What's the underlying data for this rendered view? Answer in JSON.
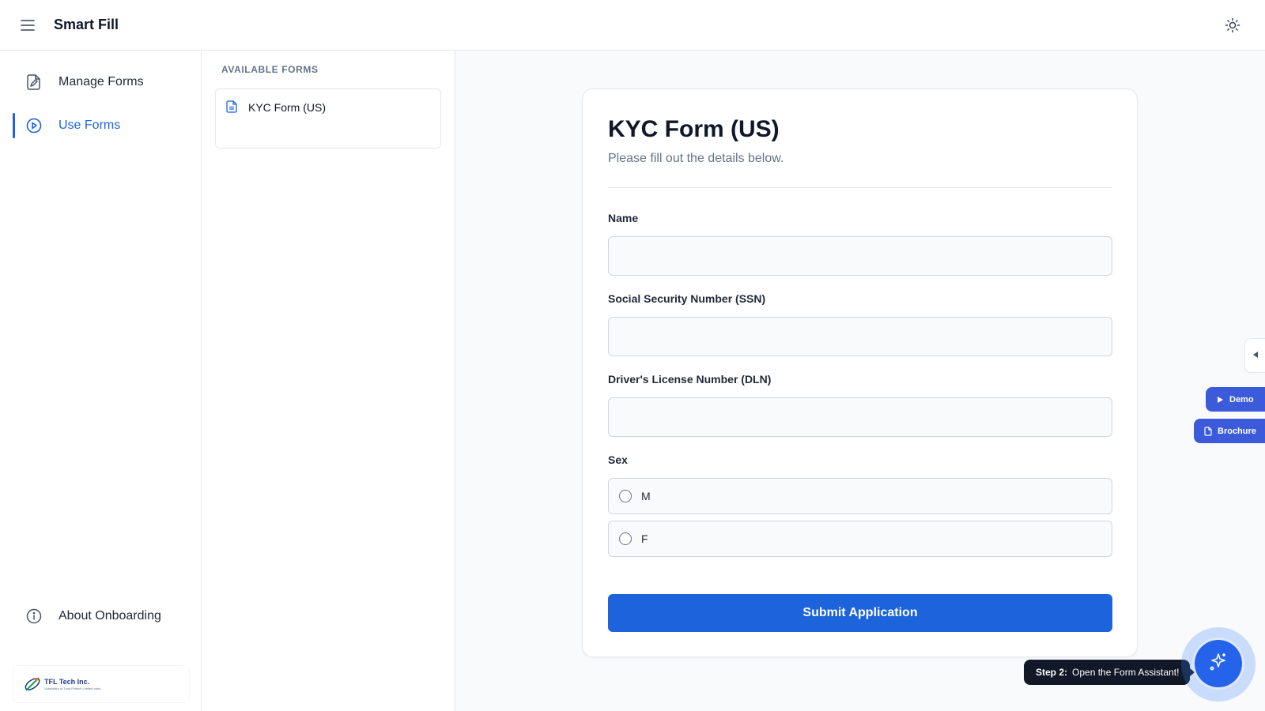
{
  "header": {
    "title": "Smart Fill",
    "menu_icon": "hamburger-menu-icon",
    "theme_icon": "sun-icon"
  },
  "sidebar": {
    "items": [
      {
        "label": "Manage Forms",
        "icon": "document-edit-icon",
        "active": false
      },
      {
        "label": "Use Forms",
        "icon": "play-circle-icon",
        "active": true
      }
    ],
    "footer_item": {
      "label": "About Onboarding",
      "icon": "info-icon"
    },
    "logo": {
      "name": "TFL Tech Inc.",
      "tagline": "Subsidiary of Trust Fintech Limited India"
    }
  },
  "forms_list": {
    "heading": "AVAILABLE FORMS",
    "items": [
      {
        "label": "KYC Form (US)",
        "icon": "document-icon"
      }
    ]
  },
  "form": {
    "title": "KYC Form (US)",
    "subtitle": "Please fill out the details below.",
    "fields": [
      {
        "label": "Name",
        "value": "",
        "placeholder": ""
      },
      {
        "label": "Social Security Number (SSN)",
        "value": "",
        "placeholder": ""
      },
      {
        "label": "Driver's License Number (DLN)",
        "value": "",
        "placeholder": ""
      }
    ],
    "sex": {
      "label": "Sex",
      "options": [
        "M",
        "F"
      ],
      "selected": null
    },
    "submit_label": "Submit Application"
  },
  "widgets": {
    "demo_label": "Demo",
    "brochure_label": "Brochure",
    "tooltip_step": "Step 2:",
    "tooltip_text": "Open the Form Assistant!",
    "assistant_icon": "sparkles-icon"
  },
  "colors": {
    "accent": "#1d63dc",
    "widget_blue": "#3b5bdb",
    "tooltip_bg": "#111827"
  }
}
